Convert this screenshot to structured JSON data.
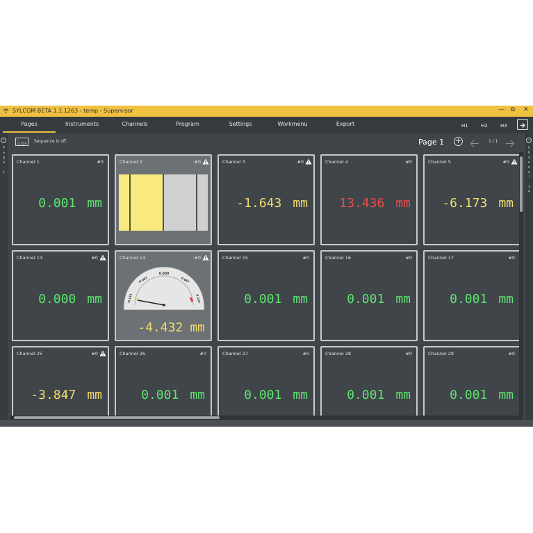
{
  "window": {
    "title": "SYLCOM BETA 1.1.1263  - temp - Supervisor",
    "controls": [
      "minimize-icon",
      "restore-icon",
      "close-icon"
    ]
  },
  "menu": {
    "tabs": [
      "Pages",
      "Instruments",
      "Channels",
      "Program",
      "Settings",
      "Workmenu",
      "Export"
    ],
    "active": "Pages",
    "history": [
      "H1",
      "H2",
      "H3"
    ]
  },
  "toolbar": {
    "sequence_icon_text": "12.456",
    "sequence_status": "Sequence is off",
    "page_label": "Page 1",
    "page_count": "1 / 1"
  },
  "side_left": {
    "label": "Page 1"
  },
  "side_right": {
    "label": "Channel 14"
  },
  "channels": [
    {
      "name": "Channel 1",
      "index": "#0",
      "warning": false,
      "value": "0.001",
      "unit": "mm",
      "color": "#5fe36f"
    },
    {
      "name": "Channel 2",
      "index": "#0",
      "warning": true,
      "display": "bars"
    },
    {
      "name": "Channel 3",
      "index": "#0",
      "warning": true,
      "value": "-1.643",
      "unit": "mm",
      "color": "#f2dc6a"
    },
    {
      "name": "Channel 4",
      "index": "#0",
      "warning": false,
      "value": "13.436",
      "unit": "mm",
      "color": "#ef4a4a"
    },
    {
      "name": "Channel 5",
      "index": "#0",
      "warning": true,
      "value": "-6.173",
      "unit": "mm",
      "color": "#f2dc6a"
    },
    {
      "name": "Channel 13",
      "index": "#0",
      "warning": true,
      "value": "0.000",
      "unit": "mm",
      "color": "#5fe36f"
    },
    {
      "name": "Channel 14",
      "index": "#0",
      "warning": true,
      "display": "gauge",
      "value": "-4.432",
      "unit": "mm",
      "color": "#f2dc6a",
      "gauge": {
        "min_label": "-0.133",
        "max_label": "0.133",
        "center_label": "0.000",
        "left_label": "-0.067",
        "right_label": "0.067"
      }
    },
    {
      "name": "Channel 15",
      "index": "#0",
      "warning": false,
      "value": "0.001",
      "unit": "mm",
      "color": "#5fe36f"
    },
    {
      "name": "Channel 16",
      "index": "#0",
      "warning": false,
      "value": "0.001",
      "unit": "mm",
      "color": "#5fe36f"
    },
    {
      "name": "Channel 17",
      "index": "#0",
      "warning": false,
      "value": "0.001",
      "unit": "mm",
      "color": "#5fe36f"
    },
    {
      "name": "Channel 25",
      "index": "#0",
      "warning": true,
      "value": "-3.847",
      "unit": "mm",
      "color": "#f2dc6a"
    },
    {
      "name": "Channel 26",
      "index": "#0",
      "warning": false,
      "value": "0.001",
      "unit": "mm",
      "color": "#5fe36f"
    },
    {
      "name": "Channel 27",
      "index": "#0",
      "warning": false,
      "value": "0.001",
      "unit": "mm",
      "color": "#5fe36f"
    },
    {
      "name": "Channel 28",
      "index": "#0",
      "warning": false,
      "value": "0.001",
      "unit": "mm",
      "color": "#5fe36f"
    },
    {
      "name": "Channel 29",
      "index": "#0",
      "warning": false,
      "value": "0.001",
      "unit": "mm",
      "color": "#5fe36f"
    }
  ]
}
